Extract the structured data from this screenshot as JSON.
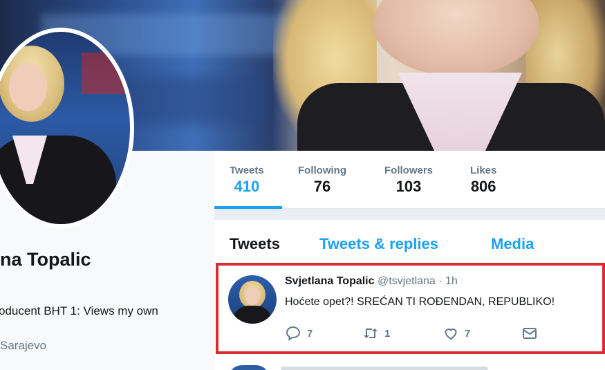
{
  "profile": {
    "name": "na Topalic",
    "bio": "oducent BHT 1: Views my own",
    "location": "Sarajevo"
  },
  "stats": [
    {
      "label": "Tweets",
      "value": "410"
    },
    {
      "label": "Following",
      "value": "76"
    },
    {
      "label": "Followers",
      "value": "103"
    },
    {
      "label": "Likes",
      "value": "806"
    }
  ],
  "tabs": [
    {
      "label": "Tweets"
    },
    {
      "label": "Tweets & replies"
    },
    {
      "label": "Media"
    }
  ],
  "tweet": {
    "author_name": "Svjetlana Topalic",
    "author_handle": "@tsvjetlana · 1h",
    "text": "Hoćete opet?! SREĆAN TI ROĐENDAN, REPUBLIKO!",
    "reply_count": "7",
    "retweet_count": "1",
    "like_count": "7"
  },
  "colors": {
    "accent": "#1da1f2",
    "highlight_border": "#d62e2e"
  },
  "icons": [
    "reply-icon",
    "retweet-icon",
    "like-icon",
    "direct-message-icon"
  ]
}
